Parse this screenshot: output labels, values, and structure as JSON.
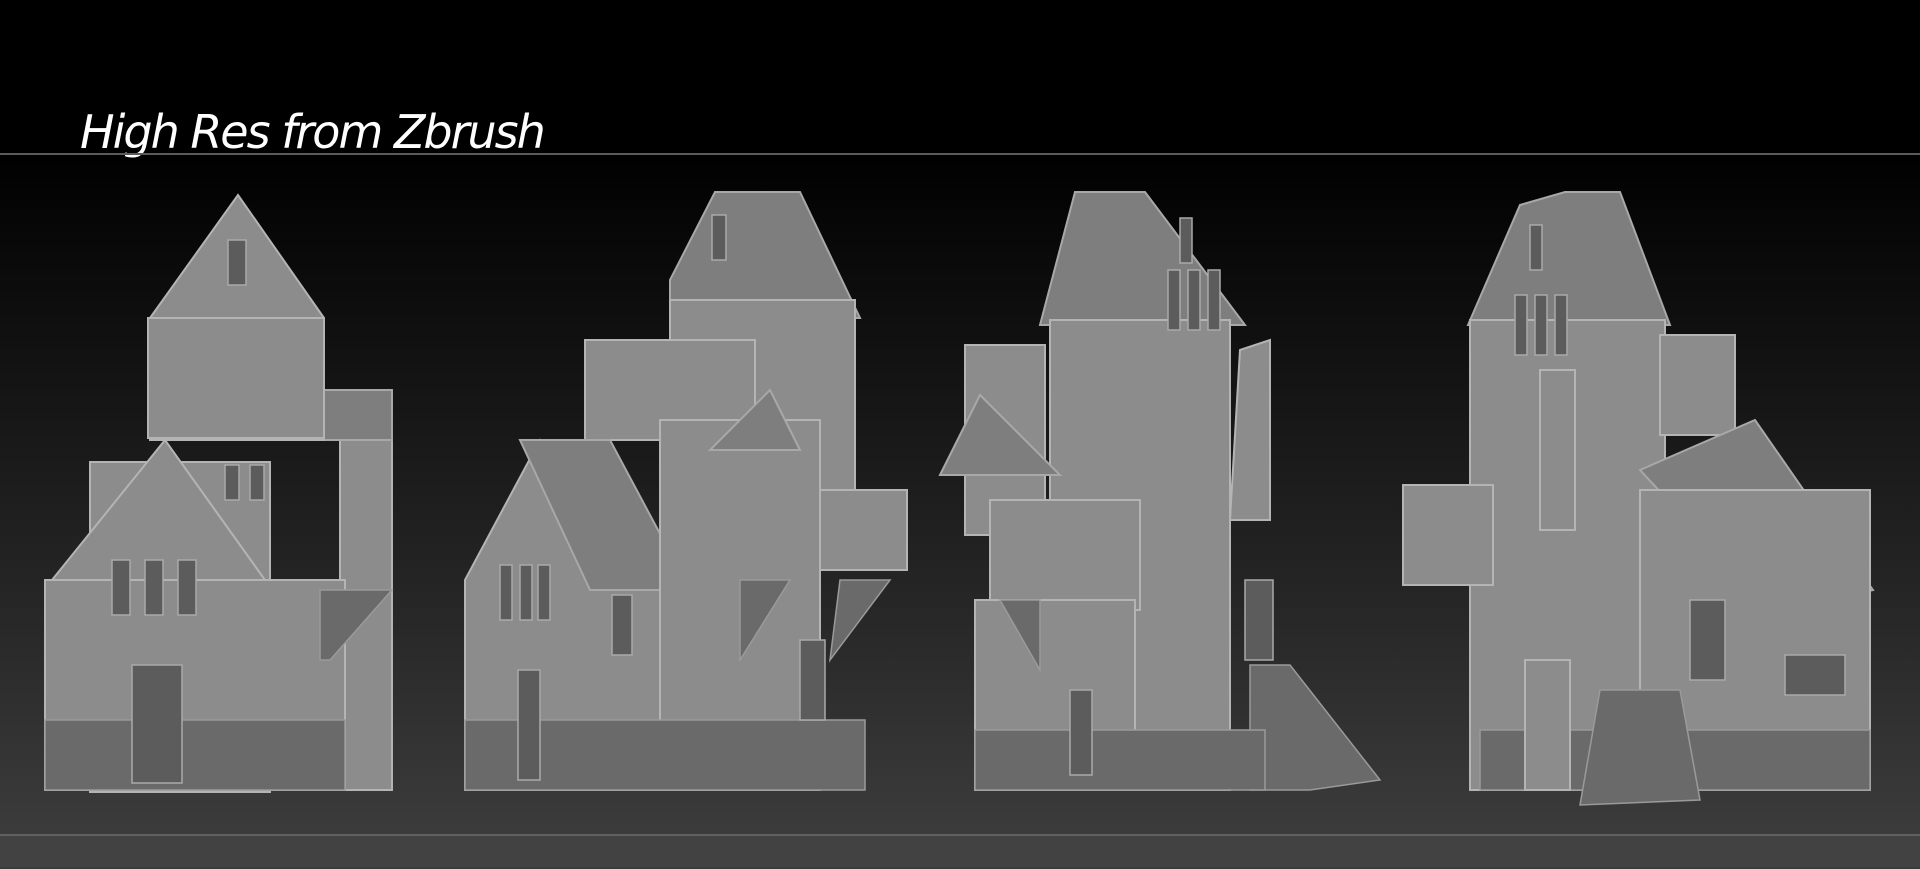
{
  "header": {
    "title": "High Res from Zbrush"
  },
  "renders": [
    {
      "name": "building-view-front"
    },
    {
      "name": "building-view-three-quarter-left"
    },
    {
      "name": "building-view-side"
    },
    {
      "name": "building-view-back"
    }
  ]
}
